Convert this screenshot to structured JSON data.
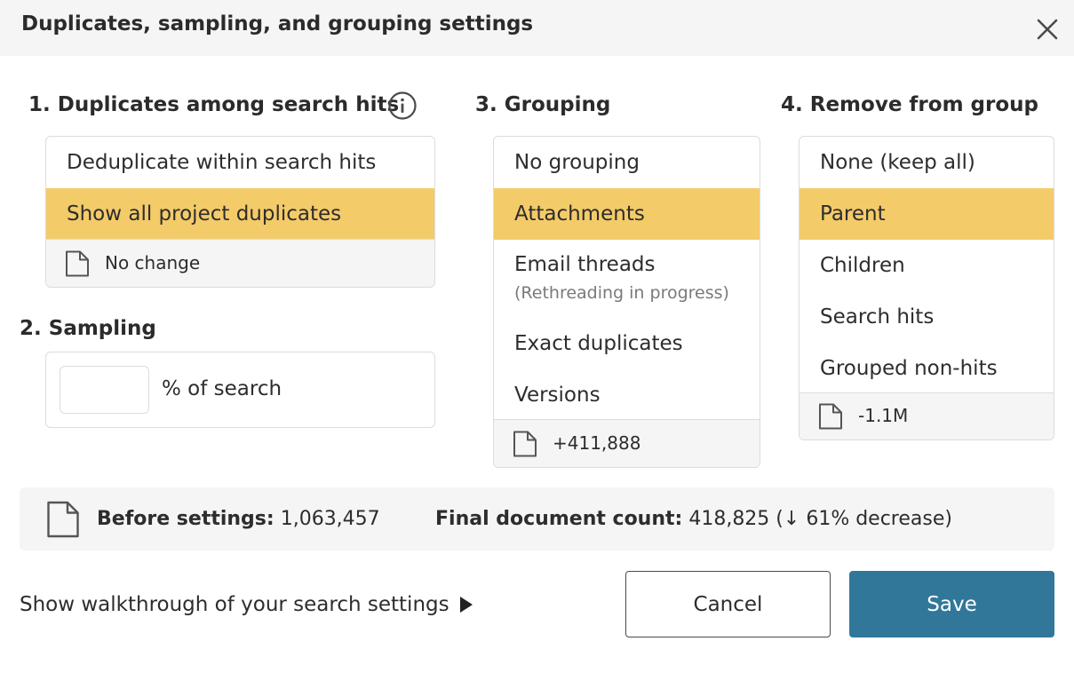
{
  "dialog": {
    "title": "Duplicates, sampling, and grouping settings"
  },
  "duplicates": {
    "title": "1. Duplicates among search hits",
    "options": [
      "Deduplicate within search hits",
      "Show all project duplicates"
    ],
    "selected": "Show all project duplicates",
    "footer": "No change"
  },
  "sampling": {
    "title": "2. Sampling",
    "value": "",
    "unit_label": "% of search"
  },
  "grouping": {
    "title": "3. Grouping",
    "options": [
      {
        "label": "No grouping",
        "note": ""
      },
      {
        "label": "Attachments",
        "note": ""
      },
      {
        "label": "Email threads",
        "note": "(Rethreading in progress)"
      },
      {
        "label": "Exact duplicates",
        "note": ""
      },
      {
        "label": "Versions",
        "note": ""
      }
    ],
    "selected": "Attachments",
    "footer": "+411,888"
  },
  "remove": {
    "title": "4. Remove from group",
    "options": [
      "None (keep all)",
      "Parent",
      "Children",
      "Search hits",
      "Grouped non-hits"
    ],
    "selected": "Parent",
    "footer": "-1.1M"
  },
  "summary": {
    "before_label": "Before settings:",
    "before_value": "1,063,457",
    "final_label": "Final document count:",
    "final_value": "418,825 (",
    "change_arrow": "↓",
    "change_text": " 61% decrease)"
  },
  "actions": {
    "walkthrough": "Show walkthrough of your search settings",
    "cancel": "Cancel",
    "save": "Save"
  },
  "colors": {
    "selected": "#f4cb69",
    "save_button": "#31779a",
    "panel_bg": "#f4f5f4"
  }
}
